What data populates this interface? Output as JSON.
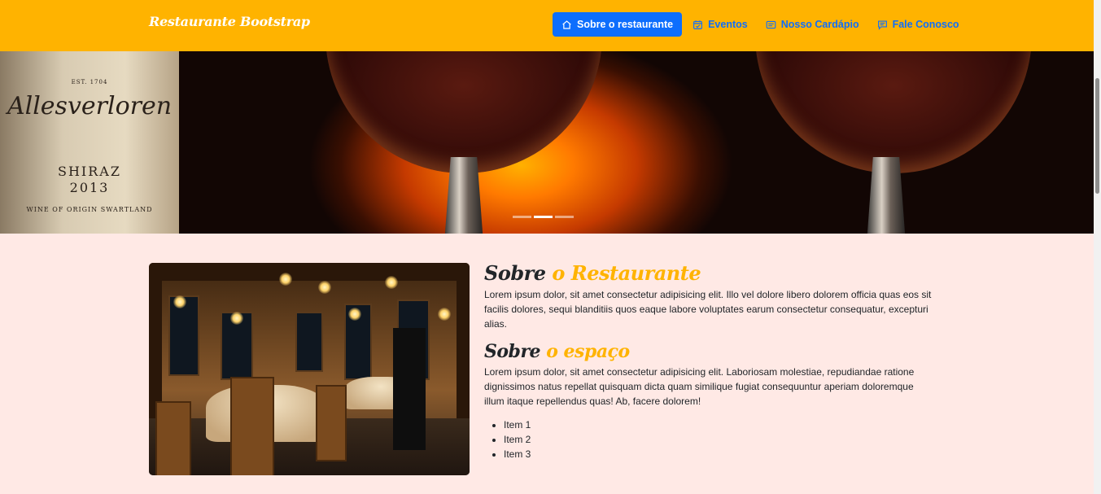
{
  "navbar": {
    "brand": "Restaurante Bootstrap",
    "items": [
      {
        "label": "Sobre o restaurante",
        "icon": "house-icon",
        "active": true
      },
      {
        "label": "Eventos",
        "icon": "calendar-check-icon",
        "active": false
      },
      {
        "label": "Nosso Cardápio",
        "icon": "menu-card-icon",
        "active": false
      },
      {
        "label": "Fale Conosco",
        "icon": "chat-icon",
        "active": false
      }
    ]
  },
  "hero": {
    "bottle_label": {
      "est": "EST. 1704",
      "name": "Allesverloren",
      "variety": "SHIRAZ",
      "year": "2013",
      "origin": "WINE OF ORIGIN SWARTLAND"
    },
    "slides_count": 3,
    "active_slide": 2
  },
  "about": {
    "section1": {
      "title_dark": "Sobre",
      "title_accent": "o Restaurante",
      "text": "Lorem ipsum dolor, sit amet consectetur adipisicing elit. Illo vel dolore libero dolorem officia quas eos sit facilis dolores, sequi blanditiis quos eaque labore voluptates earum consectetur consequatur, excepturi alias."
    },
    "section2": {
      "title_dark": "Sobre",
      "title_accent": "o espaço",
      "text": "Lorem ipsum dolor, sit amet consectetur adipisicing elit. Laboriosam molestiae, repudiandae ratione dignissimos natus repellat quisquam dicta quam similique fugiat consequuntur aperiam doloremque illum itaque repellendus quas! Ab, facere dolorem!"
    },
    "list": [
      "Item 1",
      "Item 2",
      "Item 3"
    ]
  },
  "colors": {
    "navbar_bg": "#ffb300",
    "active_button": "#0d6efd",
    "nav_link": "#0d6efd",
    "page_bg": "#ffe9e5",
    "accent_text": "#ffb300"
  }
}
